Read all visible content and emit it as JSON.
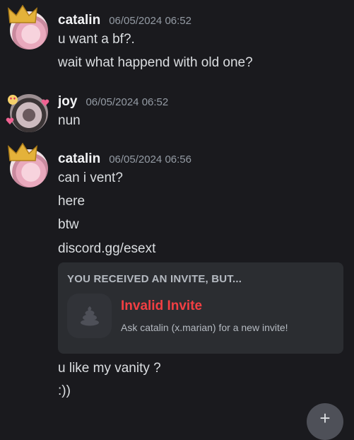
{
  "messages": [
    {
      "author": "catalin",
      "timestamp": "06/05/2024 06:52",
      "lines": [
        "u want a bf?.",
        "wait what happend with old one?"
      ]
    },
    {
      "author": "joy",
      "timestamp": "06/05/2024 06:52",
      "lines": [
        "nun"
      ]
    },
    {
      "author": "catalin",
      "timestamp": "06/05/2024 06:56",
      "lines": [
        "can i vent?",
        "here",
        "btw",
        "discord.gg/esext",
        "u like my vanity ?",
        ":))"
      ]
    }
  ],
  "invite_embed": {
    "header": "YOU RECEIVED AN INVITE, BUT...",
    "title": "Invalid Invite",
    "subtitle": "Ask catalin (x.marian) for a new invite!"
  },
  "fab": {
    "icon": "plus-icon",
    "glyph": "+"
  },
  "colors": {
    "background": "#1a1a1e",
    "embed_background": "#2b2d31",
    "error_red": "#f23f43",
    "timestamp_gray": "#949ba4"
  }
}
